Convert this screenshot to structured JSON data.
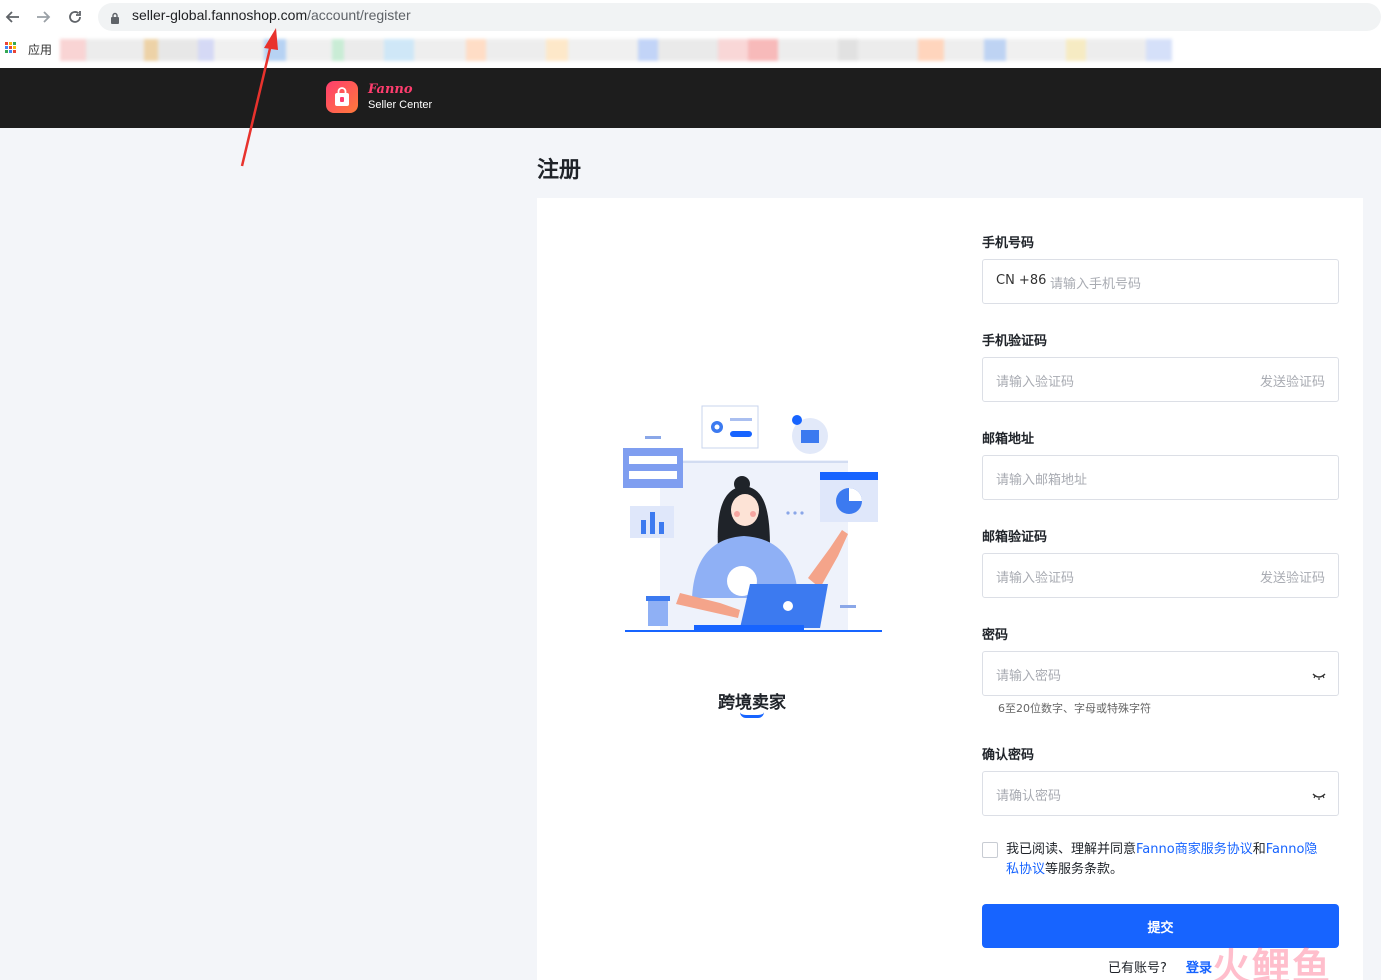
{
  "browser": {
    "url_host": "seller-global.fannoshop.com",
    "url_path": "/account/register",
    "apps_label": "应用"
  },
  "header": {
    "brand_name": "Fanno",
    "brand_sub": "Seller Center"
  },
  "page": {
    "title": "注册"
  },
  "illustration": {
    "caption": "跨境卖家"
  },
  "form": {
    "phone": {
      "label": "手机号码",
      "prefix": "CN +86",
      "placeholder": "请输入手机号码"
    },
    "phone_code": {
      "label": "手机验证码",
      "placeholder": "请输入验证码",
      "action": "发送验证码"
    },
    "email": {
      "label": "邮箱地址",
      "placeholder": "请输入邮箱地址"
    },
    "email_code": {
      "label": "邮箱验证码",
      "placeholder": "请输入验证码",
      "action": "发送验证码"
    },
    "password": {
      "label": "密码",
      "placeholder": "请输入密码",
      "hint": "6至20位数字、字母或特殊字符"
    },
    "confirm_password": {
      "label": "确认密码",
      "placeholder": "请确认密码"
    },
    "agreement": {
      "prefix": "我已阅读、理解并同意",
      "link1": "Fanno商家服务协议",
      "middle": "和",
      "link2_part1": "Fanno隐",
      "link2_part2": "私协议",
      "suffix": "等服务条款。"
    },
    "submit_label": "提交",
    "have_account": "已有账号?",
    "login_label": "登录"
  },
  "watermark": "火鲤鱼",
  "colors": {
    "primary": "#1764ff",
    "topbar": "#1d1d1d",
    "brand": "#ff3d6e",
    "arrow": "#e8322d"
  }
}
